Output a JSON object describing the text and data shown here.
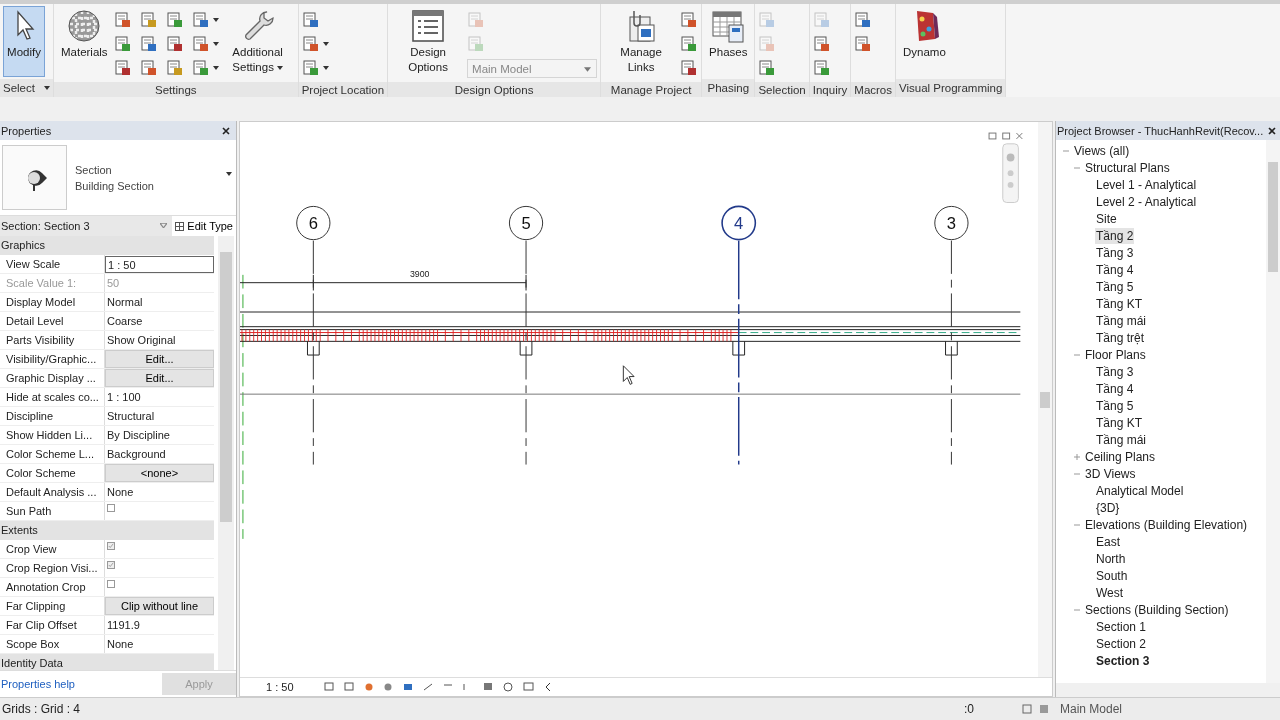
{
  "ribbon": {
    "panels": [
      {
        "title": "Select",
        "dropdown": true,
        "tools": [
          {
            "kind": "large",
            "label": "Modify",
            "selected": true,
            "dropdown": false
          }
        ]
      },
      {
        "title": "Settings",
        "dropdown": false,
        "tools": [
          {
            "kind": "large",
            "label": "Materials",
            "selected": false,
            "dropdown": false
          },
          {
            "kind": "small",
            "disabled": false,
            "dropdown": false
          },
          {
            "kind": "small",
            "disabled": false,
            "dropdown": false
          },
          {
            "kind": "small",
            "disabled": false,
            "dropdown": false
          },
          {
            "kind": "small",
            "disabled": false,
            "dropdown": false
          },
          {
            "kind": "small",
            "disabled": false,
            "dropdown": false
          },
          {
            "kind": "small",
            "disabled": false,
            "dropdown": false
          },
          {
            "kind": "small",
            "disabled": false,
            "dropdown": false
          },
          {
            "kind": "small",
            "disabled": false,
            "dropdown": false
          },
          {
            "kind": "small",
            "disabled": false,
            "dropdown": false
          },
          {
            "kind": "small",
            "disabled": false,
            "dropdown": true
          },
          {
            "kind": "small",
            "disabled": false,
            "dropdown": true
          },
          {
            "kind": "small",
            "disabled": false,
            "dropdown": true
          },
          {
            "kind": "large",
            "label": "Additional Settings",
            "selected": false,
            "dropdown": true
          }
        ]
      },
      {
        "title": "Project Location",
        "dropdown": false,
        "tools": [
          {
            "kind": "small",
            "disabled": false,
            "dropdown": false
          },
          {
            "kind": "small",
            "disabled": false,
            "dropdown": true
          },
          {
            "kind": "small",
            "disabled": false,
            "dropdown": true
          }
        ]
      },
      {
        "title": "Design Options",
        "dropdown": false,
        "tools": [
          {
            "kind": "large",
            "label": "Design Options",
            "selected": false,
            "dropdown": false
          },
          {
            "kind": "small",
            "disabled": true,
            "dropdown": false
          },
          {
            "kind": "small",
            "disabled": true,
            "dropdown": false
          },
          {
            "kind": "combo",
            "value": "Main Model",
            "disabled": true
          }
        ]
      },
      {
        "title": "Manage Project",
        "dropdown": false,
        "tools": [
          {
            "kind": "large",
            "label": "Manage Links",
            "selected": false,
            "dropdown": false
          },
          {
            "kind": "small",
            "disabled": false,
            "dropdown": false
          },
          {
            "kind": "small",
            "disabled": false,
            "dropdown": false
          },
          {
            "kind": "small",
            "disabled": false,
            "dropdown": false
          }
        ]
      },
      {
        "title": "Phasing",
        "dropdown": false,
        "tools": [
          {
            "kind": "large",
            "label": "Phases",
            "selected": false,
            "dropdown": false
          }
        ]
      },
      {
        "title": "Selection",
        "dropdown": false,
        "tools": [
          {
            "kind": "small",
            "disabled": true,
            "dropdown": false
          },
          {
            "kind": "small",
            "disabled": true,
            "dropdown": false
          },
          {
            "kind": "small",
            "disabled": false,
            "dropdown": false
          }
        ]
      },
      {
        "title": "Inquiry",
        "dropdown": false,
        "tools": [
          {
            "kind": "small",
            "disabled": true,
            "dropdown": false
          },
          {
            "kind": "small",
            "disabled": false,
            "dropdown": false
          },
          {
            "kind": "small",
            "disabled": false,
            "dropdown": false
          }
        ]
      },
      {
        "title": "Macros",
        "dropdown": false,
        "tools": [
          {
            "kind": "small",
            "disabled": false,
            "dropdown": false
          },
          {
            "kind": "small",
            "disabled": false,
            "dropdown": false
          }
        ]
      },
      {
        "title": "Visual Programming",
        "dropdown": false,
        "tools": [
          {
            "kind": "large",
            "label": "Dynamo",
            "selected": false,
            "dropdown": false
          }
        ]
      }
    ]
  },
  "properties": {
    "title": "Properties",
    "type_name": "Section",
    "type_family": "Building Section",
    "instance": "Section: Section 3",
    "edit_type": "Edit Type",
    "groups": [
      {
        "title": "Graphics",
        "rows": [
          {
            "label": "View Scale",
            "value": "1 : 50",
            "kind": "input",
            "disabled": false
          },
          {
            "label": "Scale Value    1:",
            "value": "50",
            "kind": "text",
            "disabled": true
          },
          {
            "label": "Display Model",
            "value": "Normal",
            "kind": "text",
            "disabled": false
          },
          {
            "label": "Detail Level",
            "value": "Coarse",
            "kind": "text",
            "disabled": false
          },
          {
            "label": "Parts Visibility",
            "value": "Show Original",
            "kind": "text",
            "disabled": false
          },
          {
            "label": "Visibility/Graphic...",
            "value": "Edit...",
            "kind": "button",
            "disabled": false
          },
          {
            "label": "Graphic Display ...",
            "value": "Edit...",
            "kind": "button",
            "disabled": false
          },
          {
            "label": "Hide at scales co...",
            "value": "1 : 100",
            "kind": "text",
            "disabled": false
          },
          {
            "label": "Discipline",
            "value": "Structural",
            "kind": "text",
            "disabled": false
          },
          {
            "label": "Show Hidden Li...",
            "value": "By Discipline",
            "kind": "text",
            "disabled": false
          },
          {
            "label": "Color Scheme L...",
            "value": "Background",
            "kind": "text",
            "disabled": false
          },
          {
            "label": "Color Scheme",
            "value": "<none>",
            "kind": "button",
            "disabled": false
          },
          {
            "label": "Default Analysis ...",
            "value": "None",
            "kind": "text",
            "disabled": false
          },
          {
            "label": "Sun Path",
            "kind": "checkbox",
            "checked": false,
            "disabled": false
          }
        ]
      },
      {
        "title": "Extents",
        "rows": [
          {
            "label": "Crop View",
            "kind": "checkbox",
            "checked": true,
            "disabled": false
          },
          {
            "label": "Crop Region Visi...",
            "kind": "checkbox",
            "checked": true,
            "disabled": false
          },
          {
            "label": "Annotation Crop",
            "kind": "checkbox",
            "checked": false,
            "disabled": false
          },
          {
            "label": "Far Clipping",
            "value": "Clip without line",
            "kind": "button",
            "disabled": false
          },
          {
            "label": "Far Clip Offset",
            "value": "1191.9",
            "kind": "text",
            "disabled": false
          },
          {
            "label": "Scope Box",
            "value": "None",
            "kind": "text",
            "disabled": false
          }
        ]
      },
      {
        "title": "Identity Data"
      }
    ],
    "help_link": "Properties help",
    "apply": {
      "label": "Apply",
      "disabled": true
    }
  },
  "view": {
    "grids": [
      {
        "label": "6",
        "selected": false
      },
      {
        "label": "5",
        "selected": false
      },
      {
        "label": "4",
        "selected": true
      },
      {
        "label": "3",
        "selected": false
      }
    ],
    "dimension": "3900",
    "scale": "1 : 50"
  },
  "browser": {
    "title": "Project Browser - ThucHanhRevit(Recov...",
    "tree": [
      {
        "label": "Views (all)",
        "expanded": true,
        "selected": false,
        "open": false,
        "children": [
          {
            "label": "Structural Plans",
            "expanded": true,
            "selected": false,
            "open": false,
            "children": [
              {
                "label": "Level 1 - Analytical",
                "selected": false,
                "open": false
              },
              {
                "label": "Level 2 - Analytical",
                "selected": false,
                "open": false
              },
              {
                "label": "Site",
                "selected": false,
                "open": false
              },
              {
                "label": "Tầng 2",
                "selected": true,
                "open": false
              },
              {
                "label": "Tầng 3",
                "selected": false,
                "open": false
              },
              {
                "label": "Tầng 4",
                "selected": false,
                "open": false
              },
              {
                "label": "Tầng 5",
                "selected": false,
                "open": false
              },
              {
                "label": "Tầng KT",
                "selected": false,
                "open": false
              },
              {
                "label": "Tầng mái",
                "selected": false,
                "open": false
              },
              {
                "label": "Tầng trệt",
                "selected": false,
                "open": false
              }
            ]
          },
          {
            "label": "Floor Plans",
            "expanded": true,
            "selected": false,
            "open": false,
            "children": [
              {
                "label": "Tầng 3",
                "selected": false,
                "open": false
              },
              {
                "label": "Tầng 4",
                "selected": false,
                "open": false
              },
              {
                "label": "Tầng 5",
                "selected": false,
                "open": false
              },
              {
                "label": "Tầng KT",
                "selected": false,
                "open": false
              },
              {
                "label": "Tầng mái",
                "selected": false,
                "open": false
              }
            ]
          },
          {
            "label": "Ceiling Plans",
            "expanded": false,
            "selected": false,
            "open": false
          },
          {
            "label": "3D Views",
            "expanded": true,
            "selected": false,
            "open": false,
            "children": [
              {
                "label": "Analytical Model",
                "selected": false,
                "open": false
              },
              {
                "label": "{3D}",
                "selected": false,
                "open": false
              }
            ]
          },
          {
            "label": "Elevations (Building Elevation)",
            "expanded": true,
            "selected": false,
            "open": false,
            "children": [
              {
                "label": "East",
                "selected": false,
                "open": false
              },
              {
                "label": "North",
                "selected": false,
                "open": false
              },
              {
                "label": "South",
                "selected": false,
                "open": false
              },
              {
                "label": "West",
                "selected": false,
                "open": false
              }
            ]
          },
          {
            "label": "Sections (Building Section)",
            "expanded": true,
            "selected": false,
            "open": false,
            "children": [
              {
                "label": "Section 1",
                "selected": false,
                "open": false
              },
              {
                "label": "Section 2",
                "selected": false,
                "open": false
              },
              {
                "label": "Section 3",
                "selected": false,
                "open": true
              }
            ]
          }
        ]
      }
    ]
  },
  "status_bar": {
    "message": "Grids : Grid : 4",
    "workset": ":0",
    "design_option": "Main Model"
  }
}
